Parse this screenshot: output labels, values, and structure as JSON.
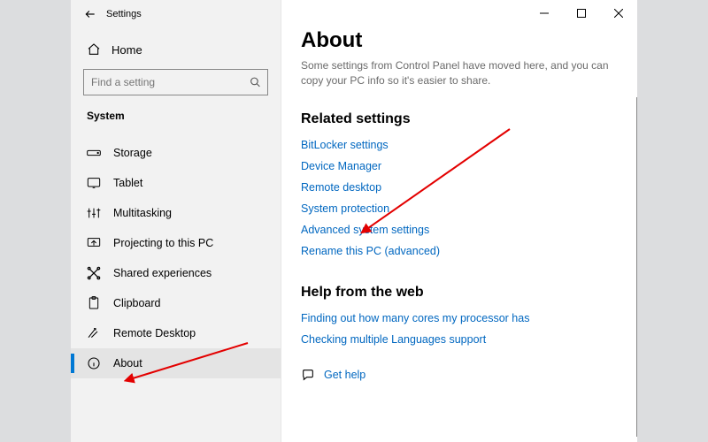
{
  "titlebar": {
    "title": "Settings"
  },
  "home": {
    "label": "Home"
  },
  "search": {
    "placeholder": "Find a setting"
  },
  "group": {
    "label": "System"
  },
  "nav": {
    "items": [
      {
        "id": "storage",
        "label": "Storage"
      },
      {
        "id": "tablet",
        "label": "Tablet"
      },
      {
        "id": "multitasking",
        "label": "Multitasking"
      },
      {
        "id": "projecting",
        "label": "Projecting to this PC"
      },
      {
        "id": "shared",
        "label": "Shared experiences"
      },
      {
        "id": "clipboard",
        "label": "Clipboard"
      },
      {
        "id": "remote",
        "label": "Remote Desktop"
      },
      {
        "id": "about",
        "label": "About"
      }
    ]
  },
  "page": {
    "title": "About",
    "description": "Some settings from Control Panel have moved here, and you can copy your PC info so it's easier to share."
  },
  "related": {
    "heading": "Related settings",
    "links": [
      "BitLocker settings",
      "Device Manager",
      "Remote desktop",
      "System protection",
      "Advanced system settings",
      "Rename this PC (advanced)"
    ]
  },
  "help": {
    "heading": "Help from the web",
    "links": [
      "Finding out how many cores my processor has",
      "Checking multiple Languages support"
    ]
  },
  "gethelp": {
    "label": "Get help"
  }
}
